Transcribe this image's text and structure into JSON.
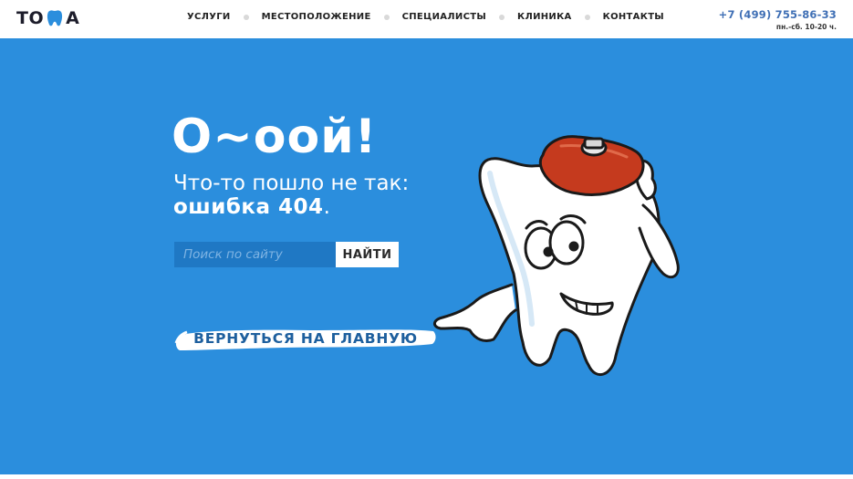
{
  "logo": {
    "text_left": "TO",
    "text_right": "A",
    "tooth_icon": "tooth-icon"
  },
  "nav": {
    "items": [
      {
        "label": "УСЛУГИ"
      },
      {
        "label": "МЕСТОПОЛОЖЕНИЕ"
      },
      {
        "label": "СПЕЦИАЛИСТЫ"
      },
      {
        "label": "КЛИНИКА"
      },
      {
        "label": "КОНТАКТЫ"
      }
    ]
  },
  "contact": {
    "phone": "+7 (499) 755-86-33",
    "hours": "пн.-сб. 10-20 ч."
  },
  "error": {
    "title": "О~оой!",
    "subtitle_line1": "Что-то пошло не так:",
    "subtitle_line2_strong": "ошибка 404",
    "subtitle_line2_end": "."
  },
  "search": {
    "placeholder": "Поиск по сайту",
    "button_label": "НАЙТИ"
  },
  "home_link": {
    "label": "ВЕРНУТЬСЯ НА ГЛАВНУЮ"
  },
  "colors": {
    "accent": "#2b8edd",
    "phone": "#3f6fb5",
    "home_link_text": "#1d5f9e",
    "ice_pack": "#c53a1e"
  },
  "illustration": {
    "icon": "sick-tooth-illustration"
  }
}
